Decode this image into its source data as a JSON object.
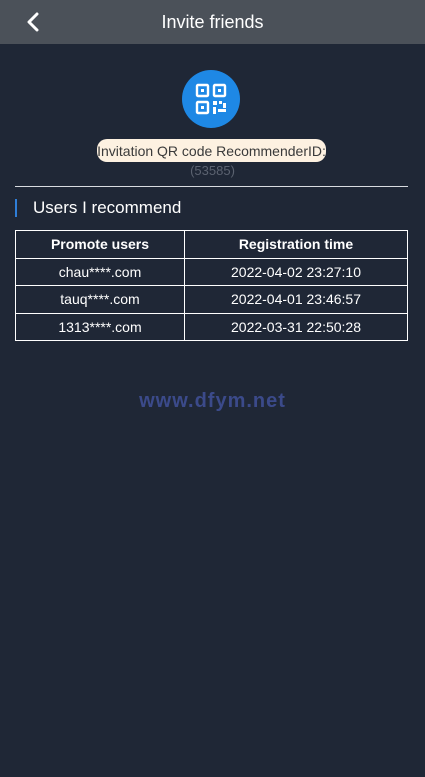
{
  "header": {
    "title": "Invite friends",
    "back_icon": "chevron-left-icon"
  },
  "invite": {
    "qr_icon": "qr-code-icon",
    "qr_color": "#1e88e5",
    "label": "Invitation QR code RecommenderID:",
    "recommender_id": "(53585)"
  },
  "section": {
    "title": "Users I recommend",
    "accent_color": "#2f7ed8"
  },
  "table": {
    "columns": [
      "Promote users",
      "Registration time"
    ],
    "rows": [
      [
        "chau****.com",
        "2022-04-02 23:27:10"
      ],
      [
        "tauq****.com",
        "2022-04-01 23:46:57"
      ],
      [
        "1313****.com",
        "2022-03-31 22:50:28"
      ]
    ]
  },
  "watermark": "www.dfym.net"
}
